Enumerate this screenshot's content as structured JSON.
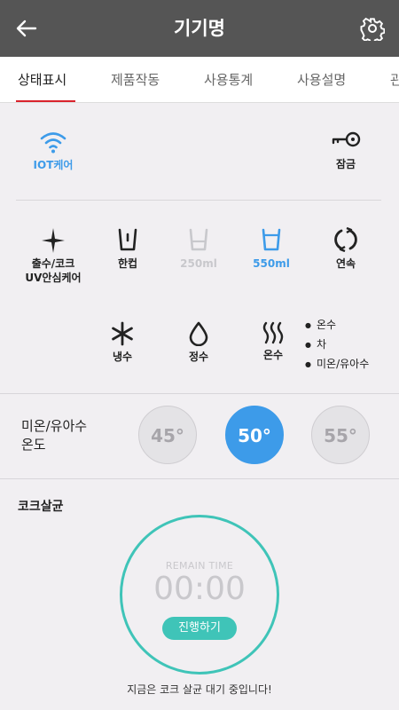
{
  "header": {
    "title": "기기명",
    "back_icon": "arrow-left-icon",
    "settings_icon": "gear-icon"
  },
  "tabs": [
    {
      "label": "상태표시",
      "active": true
    },
    {
      "label": "제품작동",
      "active": false
    },
    {
      "label": "사용통계",
      "active": false
    },
    {
      "label": "사용설명",
      "active": false
    },
    {
      "label": "관",
      "active": false
    }
  ],
  "status": {
    "iot": {
      "label": "IOT케어",
      "icon": "wifi-icon"
    },
    "lock": {
      "label": "잠금",
      "icon": "key-icon"
    }
  },
  "modes": {
    "dispense": {
      "label_line1": "출수/코크",
      "label_line2": "UV안심케어",
      "icon": "sparkle-icon"
    },
    "one_cup": {
      "label": "한컵",
      "icon": "cup-icon"
    },
    "ml250": {
      "label": "250ml",
      "icon": "cup-icon"
    },
    "ml550": {
      "label": "550ml",
      "icon": "cup-icon"
    },
    "continuous": {
      "label": "연속",
      "icon": "refresh-icon"
    },
    "cold": {
      "label": "냉수",
      "icon": "snowflake-icon"
    },
    "purified": {
      "label": "정수",
      "icon": "droplet-icon"
    },
    "hot": {
      "label": "온수",
      "icon": "steam-icon"
    }
  },
  "hot_options": [
    "온수",
    "차",
    "미온/유아수"
  ],
  "temperature": {
    "label_line1": "미온/유아수",
    "label_line2": "온도",
    "options": [
      "45°",
      "50°",
      "55°"
    ],
    "selected": "50°"
  },
  "sterilization": {
    "title": "코크살균",
    "remain_label": "REMAIN TIME",
    "remain_time": "00:00",
    "start_label": "진행하기",
    "status_message": "지금은 코크 살균 대기 중입니다!"
  },
  "colors": {
    "header": "#555555",
    "active_tab": "#d9232d",
    "blue": "#3d9be9",
    "teal": "#3fc4b8",
    "background": "#f1eff2"
  }
}
